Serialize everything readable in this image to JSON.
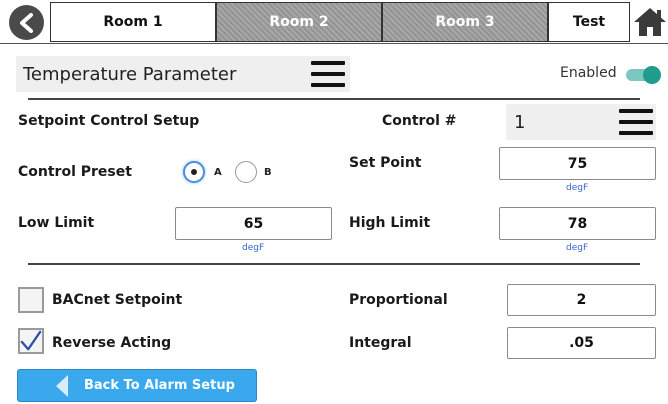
{
  "tabs": [
    {
      "label": "Room 1",
      "active": true
    },
    {
      "label": "Room 2",
      "active": false
    },
    {
      "label": "Room 3",
      "active": false
    },
    {
      "label": "Test",
      "active": true
    }
  ],
  "header": {
    "title": "Temperature Parameter",
    "enabled_label": "Enabled",
    "enabled": true
  },
  "setpoint": {
    "section_title": "Setpoint Control Setup",
    "control_label": "Control #",
    "control_value": "1",
    "preset_label": "Control Preset",
    "preset_options": [
      "A",
      "B"
    ],
    "preset_selected": "A",
    "set_point_label": "Set Point",
    "set_point_value": "75",
    "set_point_unit": "degF",
    "low_limit_label": "Low Limit",
    "low_limit_value": "65",
    "low_limit_unit": "degF",
    "high_limit_label": "High Limit",
    "high_limit_value": "78",
    "high_limit_unit": "degF"
  },
  "options": {
    "bacnet_label": "BACnet Setpoint",
    "bacnet_checked": false,
    "reverse_label": "Reverse Acting",
    "reverse_checked": true,
    "proportional_label": "Proportional",
    "proportional_value": "2",
    "integral_label": "Integral",
    "integral_value": ".05"
  },
  "footer": {
    "back_button_label": "Back To Alarm Setup"
  },
  "colors": {
    "accent_blue": "#3aa8ec",
    "toggle_on": "#1f9c8d",
    "unit_text": "#3366cc"
  }
}
